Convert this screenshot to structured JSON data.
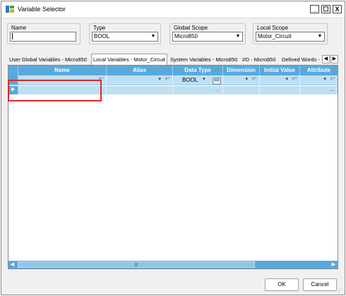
{
  "window": {
    "title": "Variable Selector",
    "minimize_glyph": "_",
    "maximize_glyph": "☐",
    "close_glyph": "X"
  },
  "filters": {
    "name": {
      "label": "Name",
      "value": ""
    },
    "type": {
      "label": "Type",
      "value": "BOOL"
    },
    "global_scope": {
      "label": "Global Scope",
      "value": "Micro850"
    },
    "local_scope": {
      "label": "Local Scope",
      "value": "Motor_Circuit"
    }
  },
  "tabs": [
    {
      "label": "User Global Variables - Micro850",
      "active": false
    },
    {
      "label": "Local Variables - Motor_Circuit",
      "active": true
    },
    {
      "label": "System Variables - Micro850",
      "active": false
    },
    {
      "label": "I/O - Micro850",
      "active": false
    },
    {
      "label": "Defined Words -",
      "active": false
    }
  ],
  "tab_scroll": {
    "left": "◀",
    "right": "▶"
  },
  "grid": {
    "columns": [
      "Name",
      "Alias",
      "Data Type",
      "Dimension",
      "Initial Value",
      "Attribute"
    ],
    "filter_row": {
      "data_type": "BOOL",
      "eq_symbol": "==",
      "filter_icon": "funnel-icon"
    },
    "new_row_marker": "✱"
  },
  "scrollbar": {
    "left": "◀",
    "right": "▶",
    "grip": "|||"
  },
  "buttons": {
    "ok": "OK",
    "cancel": "Cancel"
  },
  "colors": {
    "header": "#5aa9dc",
    "row": "#bfe0f2",
    "highlight": "#e2262a"
  }
}
